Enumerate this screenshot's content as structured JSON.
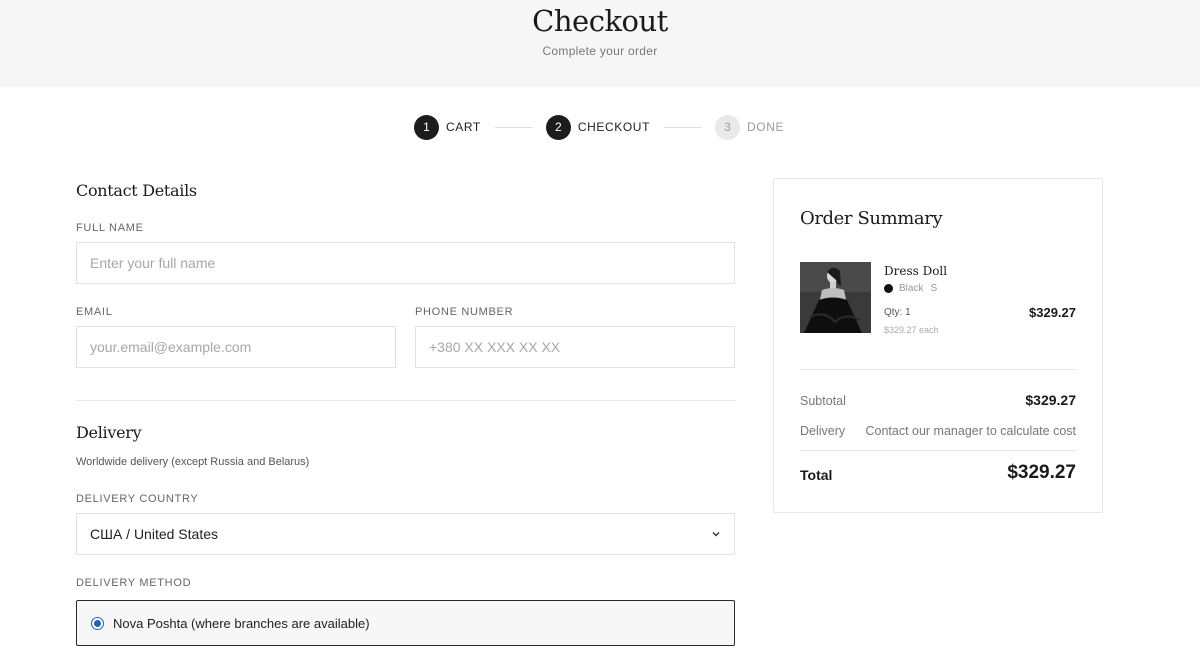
{
  "header": {
    "title": "Checkout",
    "subtitle": "Complete your order"
  },
  "steps": [
    {
      "number": "1",
      "label": "CART",
      "state": "done"
    },
    {
      "number": "2",
      "label": "CHECKOUT",
      "state": "active"
    },
    {
      "number": "3",
      "label": "DONE",
      "state": "pending"
    }
  ],
  "contact": {
    "title": "Contact Details",
    "full_name_label": "FULL NAME",
    "full_name_placeholder": "Enter your full name",
    "email_label": "EMAIL",
    "email_placeholder": "your.email@example.com",
    "phone_label": "PHONE NUMBER",
    "phone_placeholder": "+380 XX XXX XX XX"
  },
  "delivery": {
    "title": "Delivery",
    "note": "Worldwide delivery (except Russia and Belarus)",
    "country_label": "DELIVERY COUNTRY",
    "country_value": "США / United States",
    "method_label": "DELIVERY METHOD",
    "method_option": "Nova Poshta (where branches are available)",
    "method_selected": true
  },
  "summary": {
    "title": "Order Summary",
    "item": {
      "name": "Dress Doll",
      "color": "Black",
      "color_hex": "#111111",
      "size": "S",
      "qty": "Qty: 1",
      "each": "$329.27 each",
      "price": "$329.27"
    },
    "subtotal_label": "Subtotal",
    "subtotal_value": "$329.27",
    "delivery_label": "Delivery",
    "delivery_value": "Contact our manager to calculate cost",
    "total_label": "Total",
    "total_value": "$329.27"
  },
  "colors": {
    "accent_dark": "#1c1c1c",
    "radio_blue": "#1a62c9"
  }
}
